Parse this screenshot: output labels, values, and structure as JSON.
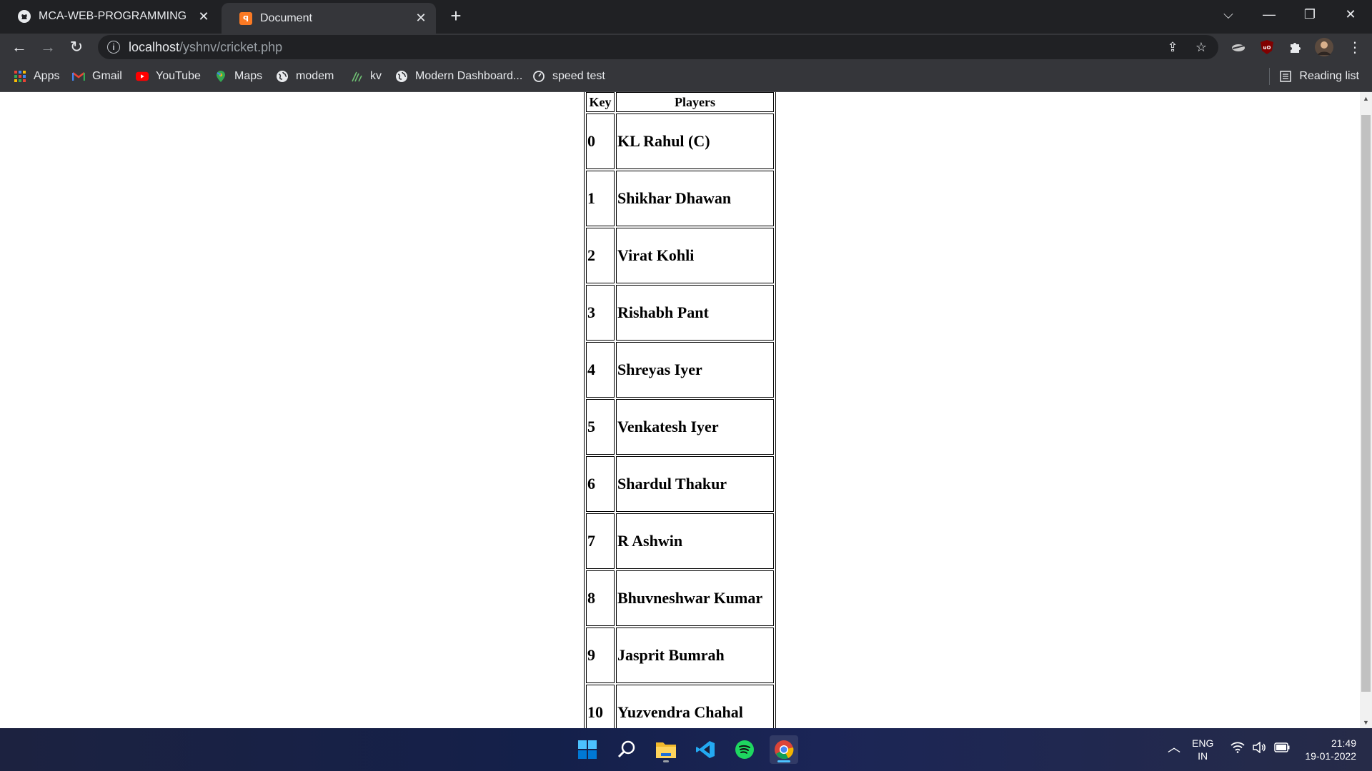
{
  "tabs": [
    {
      "title": "MCA-WEB-PROGRAMMING",
      "icon": "github-icon",
      "active": false
    },
    {
      "title": "Document",
      "icon": "xampp-icon",
      "active": true
    }
  ],
  "address_bar": {
    "host": "localhost",
    "path": "/yshnv/cricket.php"
  },
  "bookmarks": [
    {
      "label": "Apps",
      "icon": "apps-grid-icon"
    },
    {
      "label": "Gmail",
      "icon": "gmail-icon"
    },
    {
      "label": "YouTube",
      "icon": "youtube-icon"
    },
    {
      "label": "Maps",
      "icon": "maps-icon"
    },
    {
      "label": "modem",
      "icon": "globe-icon"
    },
    {
      "label": "kv",
      "icon": "kv-icon"
    },
    {
      "label": "Modern Dashboard...",
      "icon": "globe-icon"
    },
    {
      "label": "speed test",
      "icon": "speedometer-icon"
    }
  ],
  "reading_list": "Reading list",
  "table": {
    "headers": {
      "key": "Key",
      "players": "Players"
    },
    "rows": [
      {
        "key": "0",
        "player": "KL Rahul (C)"
      },
      {
        "key": "1",
        "player": "Shikhar Dhawan"
      },
      {
        "key": "2",
        "player": "Virat Kohli"
      },
      {
        "key": "3",
        "player": "Rishabh Pant"
      },
      {
        "key": "4",
        "player": "Shreyas Iyer"
      },
      {
        "key": "5",
        "player": "Venkatesh Iyer"
      },
      {
        "key": "6",
        "player": "Shardul Thakur"
      },
      {
        "key": "7",
        "player": "R Ashwin"
      },
      {
        "key": "8",
        "player": "Bhuvneshwar Kumar"
      },
      {
        "key": "9",
        "player": "Jasprit Bumrah"
      },
      {
        "key": "10",
        "player": "Yuzvendra Chahal"
      }
    ]
  },
  "taskbar": {
    "apps": [
      "windows-start-icon",
      "search-icon",
      "file-explorer-icon",
      "vscode-icon",
      "spotify-icon",
      "chrome-icon"
    ],
    "language": "ENG",
    "region": "IN",
    "time": "21:49",
    "date": "19-01-2022"
  },
  "colors": {
    "tabstrip": "#202124",
    "toolbar": "#35363a",
    "text_light": "#e8eaed",
    "taskbar": "#14204a"
  }
}
